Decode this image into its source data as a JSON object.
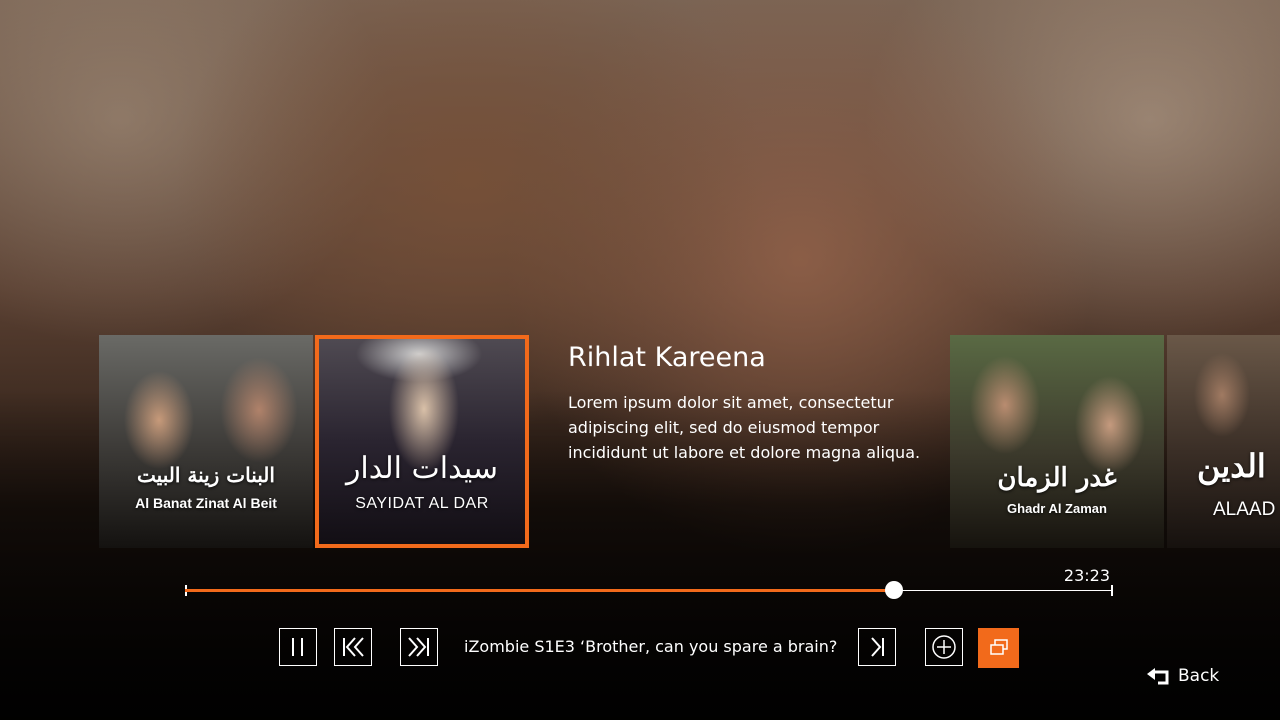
{
  "carousel": {
    "items": [
      {
        "arabic_title": "البنات زينة البيت",
        "title": "Al Banat Zinat Al Beit"
      },
      {
        "arabic_title": "سيدات الدار",
        "title": "SAYIDAT AL DAR"
      },
      {
        "arabic_title": "غدر الزمان",
        "title": "Ghadr Al Zaman"
      },
      {
        "arabic_title": "الدين",
        "title": "ALAAD"
      }
    ]
  },
  "details": {
    "title": "Rihlat Kareena",
    "description": "Lorem ipsum dolor sit amet, consectetur adipiscing elit, sed do eiusmod tempor incididunt ut labore et dolore magna aliqua."
  },
  "player": {
    "remaining_time": "23:23",
    "progress_fraction": 0.764,
    "now_playing": "iZombie S1E3 ‘Brother, can you spare a brain?",
    "accent_color": "#f26a1b"
  },
  "icons": {
    "pause": "pause-icon",
    "rewind": "skip-back-icon",
    "forward": "skip-forward-icon",
    "next": "next-episode-icon",
    "add": "add-circle-icon",
    "episodes": "stack-icon",
    "back": "back-arrow-icon"
  },
  "nav": {
    "back_label": "Back"
  }
}
